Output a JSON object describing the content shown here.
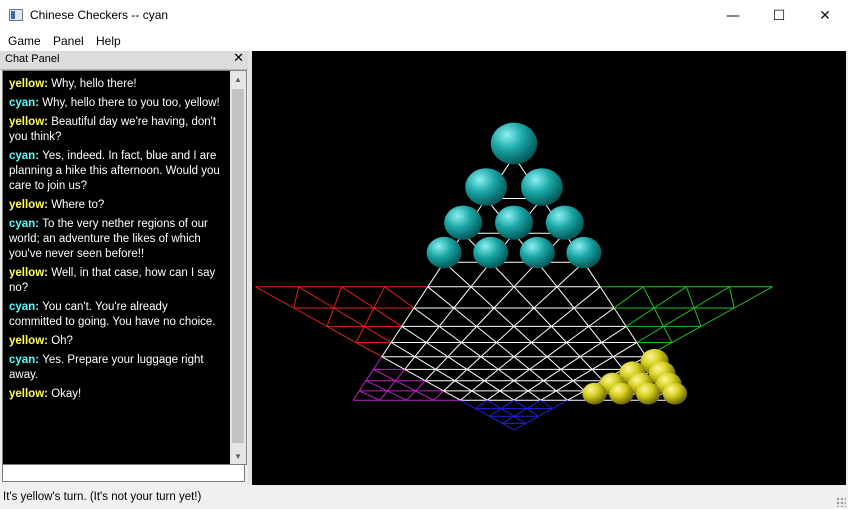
{
  "window": {
    "title": "Chinese Checkers -- cyan",
    "minimize_glyph": "—",
    "maximize_glyph": "☐",
    "close_glyph": "✕"
  },
  "menu": [
    "Game",
    "Panel",
    "Help"
  ],
  "chat": {
    "title": "Chat Panel",
    "close_glyph": "✕",
    "input_value": "",
    "sender_colors": {
      "yellow": "#ffff55",
      "cyan": "#55ffff"
    },
    "messages": [
      {
        "sender": "yellow",
        "text": "Why, hello there!"
      },
      {
        "sender": "cyan",
        "text": "Why, hello there to you too, yellow!"
      },
      {
        "sender": "yellow",
        "text": "Beautiful day we're having, don't you think?"
      },
      {
        "sender": "cyan",
        "text": "Yes, indeed.  In fact, blue and I are planning a hike this afternoon.  Would you care to join us?"
      },
      {
        "sender": "yellow",
        "text": "Where to?"
      },
      {
        "sender": "cyan",
        "text": "To the very nether regions of our world; an adventure the likes of which you've never seen before!!"
      },
      {
        "sender": "yellow",
        "text": "Well, in that case, how can I say no?"
      },
      {
        "sender": "cyan",
        "text": "You can't.  You're already committed to going. You have no choice."
      },
      {
        "sender": "yellow",
        "text": "Oh?"
      },
      {
        "sender": "cyan",
        "text": "Yes.  Prepare your luggage right away."
      },
      {
        "sender": "yellow",
        "text": "Okay!"
      }
    ]
  },
  "board": {
    "colors": {
      "grid": "#ffffff",
      "red": "#e02020",
      "green": "#20c020",
      "blue": "#2020e0",
      "magenta": "#c020c0",
      "cyan_piece": "#1aa6a6",
      "yellow_piece": "#d8d020"
    },
    "cyan_pieces": 10,
    "yellow_pieces": 10
  },
  "status": {
    "text": "It's yellow's turn.  (It's not your turn yet!)"
  }
}
